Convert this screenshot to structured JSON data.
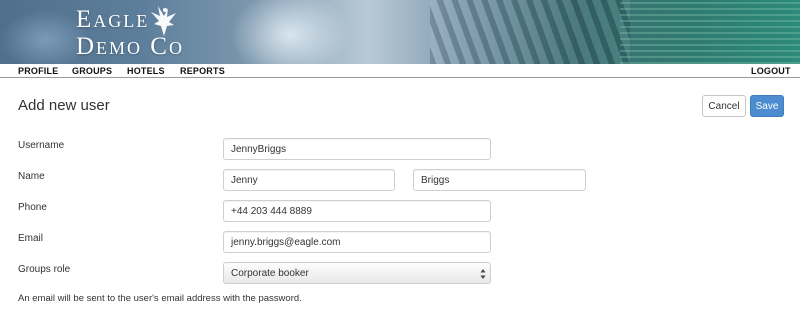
{
  "brand": {
    "line1": "Eagle",
    "line2": "Demo Co"
  },
  "nav": {
    "profile": "PROFILE",
    "groups": "GROUPS",
    "hotels": "HOTELS",
    "reports": "REPORTS",
    "logout": "LOGOUT"
  },
  "page": {
    "title": "Add new user"
  },
  "actions": {
    "cancel": "Cancel",
    "save": "Save"
  },
  "form": {
    "username": {
      "label": "Username",
      "value": "JennyBriggs"
    },
    "name": {
      "label": "Name",
      "first": "Jenny",
      "last": "Briggs"
    },
    "phone": {
      "label": "Phone",
      "value": "+44 203 444 8889"
    },
    "email": {
      "label": "Email",
      "value": "jenny.briggs@eagle.com"
    },
    "groups_role": {
      "label": "Groups role",
      "value": "Corporate booker"
    }
  },
  "note": "An email will be sent to the user's email address with the password.",
  "colors": {
    "primary_button": "#4d8dcf",
    "nav_text": "#111111"
  }
}
